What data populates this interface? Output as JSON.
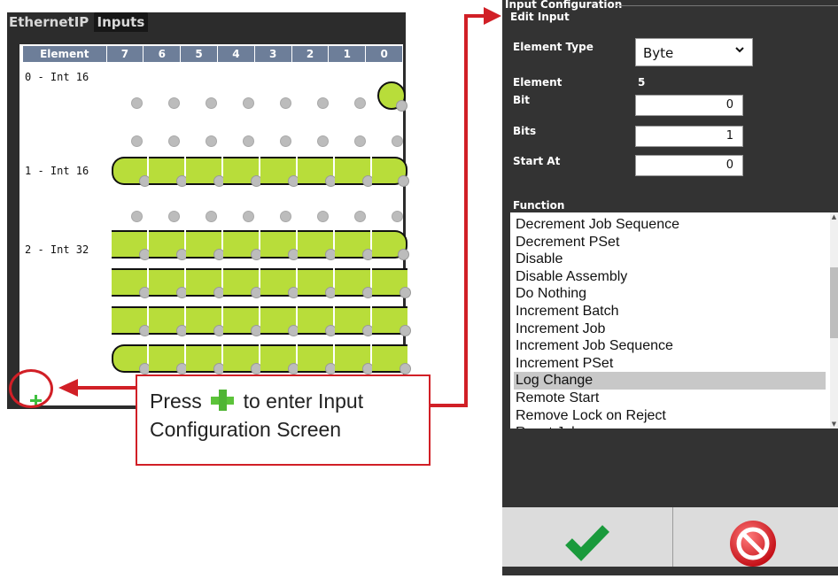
{
  "left_panel": {
    "title_part1": "EthernetIP",
    "title_part2": "Inputs",
    "grid_header": {
      "element": "Element",
      "bits": [
        "7",
        "6",
        "5",
        "4",
        "3",
        "2",
        "1",
        "0"
      ]
    },
    "rows": [
      {
        "label": "0 - Int 16"
      },
      {
        "label": "1 - Int 16"
      },
      {
        "label": "2 - Int 32"
      }
    ],
    "add_icon": "plus-icon"
  },
  "callout": {
    "line1_before": "Press",
    "line1_after": "to enter Input",
    "line2": "Configuration Screen"
  },
  "right_panel": {
    "title": "Input Configuration",
    "subtitle": "Edit Input",
    "element_type_label": "Element Type",
    "element_type_value": "Byte",
    "element_label": "Element",
    "element_value": "5",
    "bit_label": "Bit",
    "bit_value": "0",
    "bits_label": "Bits",
    "bits_value": "1",
    "start_at_label": "Start At",
    "start_at_value": "0",
    "function_label": "Function",
    "functions": [
      "Decrement Job Sequence",
      "Decrement PSet",
      "Disable",
      "Disable Assembly",
      "Do Nothing",
      "Increment Batch",
      "Increment Job",
      "Increment Job Sequence",
      "Increment PSet",
      "Log Change",
      "Remote Start",
      "Remove Lock on Reject",
      "Reset Job"
    ],
    "selected_function": "Log Change",
    "ok_icon": "checkmark-icon",
    "cancel_icon": "no-entry-icon"
  },
  "colors": {
    "accent_red": "#d11f26",
    "bit_green": "#b8dd3a",
    "header_blue": "#6d7e99",
    "check_green": "#1a9a3c"
  }
}
